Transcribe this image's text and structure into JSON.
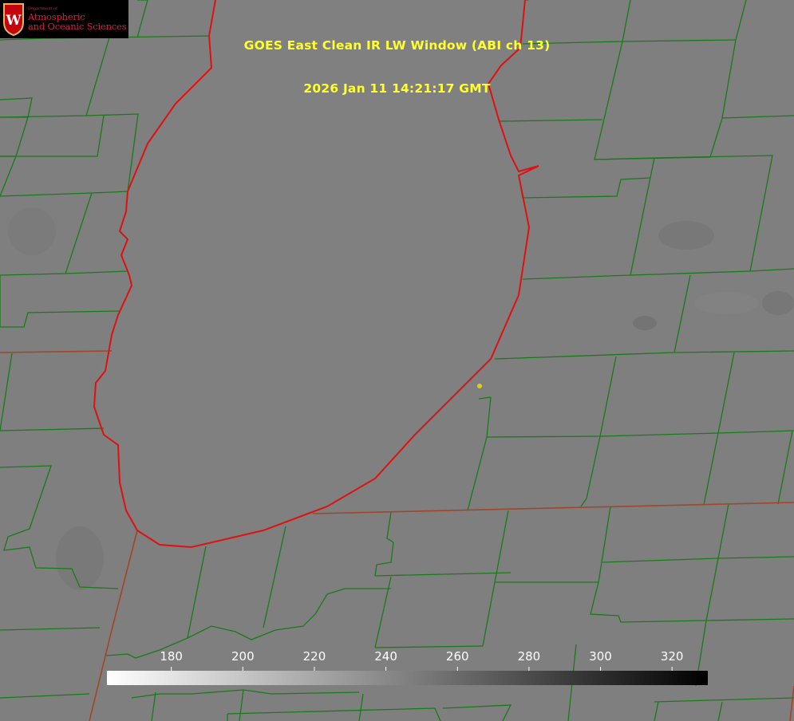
{
  "app": {
    "title_line1": "GOES East Clean IR LW Window (ABI ch 13)",
    "title_line2": "2026 Jan 11 14:21:17 GMT"
  },
  "logo": {
    "dept": "Department of",
    "line1": "Atmospheric",
    "line2": "and Oceanic Sciences",
    "emblem_letter": "W"
  },
  "colorbar": {
    "ticks": [
      {
        "value": 180,
        "label": "180"
      },
      {
        "value": 200,
        "label": "200"
      },
      {
        "value": 220,
        "label": "220"
      },
      {
        "value": 240,
        "label": "240"
      },
      {
        "value": 260,
        "label": "260"
      },
      {
        "value": 280,
        "label": "280"
      },
      {
        "value": 300,
        "label": "300"
      },
      {
        "value": 320,
        "label": "320"
      }
    ],
    "range": [
      162,
      330
    ],
    "gradient": "white-to-black"
  },
  "colors": {
    "title": "#ffff2e",
    "county_lines": "#1a7a1a",
    "state_lines": "#a0462a",
    "shoreline": "#e01010",
    "background": "#7f7f7f",
    "logo_red": "#d4203c"
  }
}
